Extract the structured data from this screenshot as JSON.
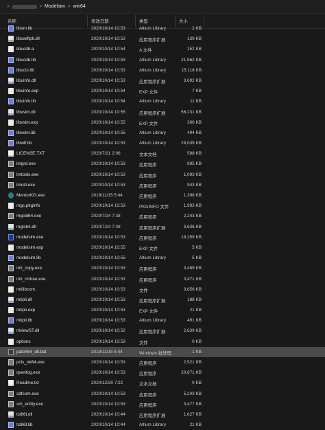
{
  "breadcrumb": {
    "sep": ">",
    "items": [
      "Modelsim",
      "win64"
    ]
  },
  "columns": {
    "name": "名称",
    "date": "修改日期",
    "type": "类型",
    "size": "大小"
  },
  "files": [
    {
      "name": "libsm.lib",
      "date": "2020/10/14 10:53",
      "type": "Altium Library",
      "size": "2 KB",
      "icon": "lib-icon"
    },
    {
      "name": "libswiftpli.dll",
      "date": "2020/10/14 10:53",
      "type": "应用程序扩展",
      "size": "139 KB",
      "icon": "dll-icon"
    },
    {
      "name": "libucdb.a",
      "date": "2020/10/14 10:54",
      "type": "A 文件",
      "size": "152 KB",
      "icon": "file-icon"
    },
    {
      "name": "libucdb.lib",
      "date": "2020/10/14 10:53",
      "type": "Altium Library",
      "size": "21,562 KB",
      "icon": "lib-icon"
    },
    {
      "name": "libucis.lib",
      "date": "2020/10/14 10:53",
      "type": "Altium Library",
      "size": "15,118 KB",
      "icon": "lib-icon"
    },
    {
      "name": "libuinfo.dll",
      "date": "2020/10/14 10:53",
      "type": "应用程序扩展",
      "size": "3,692 KB",
      "icon": "dll-icon"
    },
    {
      "name": "libuinfo.exp",
      "date": "2020/10/14 10:54",
      "type": "EXP 文件",
      "size": "7 KB",
      "icon": "file-icon"
    },
    {
      "name": "libuinfo.lib",
      "date": "2020/10/14 10:54",
      "type": "Altium Library",
      "size": "11 KB",
      "icon": "lib-icon"
    },
    {
      "name": "libvsim.dll",
      "date": "2020/10/14 10:55",
      "type": "应用程序扩展",
      "size": "56,231 KB",
      "icon": "dll-icon"
    },
    {
      "name": "libvsim.exp",
      "date": "2020/10/14 10:55",
      "type": "EXP 文件",
      "size": "300 KB",
      "icon": "file-icon"
    },
    {
      "name": "libvsim.lib",
      "date": "2020/10/14 10:55",
      "type": "Altium Library",
      "size": "494 KB",
      "icon": "lib-icon"
    },
    {
      "name": "libwlf.lib",
      "date": "2020/10/14 10:53",
      "type": "Altium Library",
      "size": "29,039 KB",
      "icon": "lib-icon"
    },
    {
      "name": "LICENSE.TXT",
      "date": "2023/7/21 2:06",
      "type": "文本文档",
      "size": "588 KB",
      "icon": "txt-icon"
    },
    {
      "name": "lmgrd.exe",
      "date": "2020/10/14 10:53",
      "type": "应用程序",
      "size": "895 KB",
      "icon": "exe-icon"
    },
    {
      "name": "lmtools.exe",
      "date": "2020/10/14 10:53",
      "type": "应用程序",
      "size": "1,093 KB",
      "icon": "exe-icon"
    },
    {
      "name": "lmutil.exe",
      "date": "2020/10/14 10:53",
      "type": "应用程序",
      "size": "943 KB",
      "icon": "exe-icon"
    },
    {
      "name": "MentorKG.exe",
      "date": "2018/11/15 5:44",
      "type": "应用程序",
      "size": "1,398 KB",
      "icon": "mentor-icon"
    },
    {
      "name": "mgc.pkginfo",
      "date": "2020/10/14 10:53",
      "type": "PKGINFO 文件",
      "size": "1,993 KB",
      "icon": "file-icon"
    },
    {
      "name": "mgcld64.exe",
      "date": "2020/7/24 7:38",
      "type": "应用程序",
      "size": "2,243 KB",
      "icon": "exe-icon"
    },
    {
      "name": "mgls64.dll",
      "date": "2020/7/24 7:38",
      "type": "应用程序扩展",
      "size": "3,636 KB",
      "icon": "dll-icon"
    },
    {
      "name": "modelsim.exe",
      "date": "2020/10/14 10:53",
      "type": "应用程序",
      "size": "19,259 KB",
      "icon": "modelsim-icon"
    },
    {
      "name": "modelsim.exp",
      "date": "2020/10/14 10:55",
      "type": "EXP 文件",
      "size": "5 KB",
      "icon": "file-icon"
    },
    {
      "name": "modelsim.lib",
      "date": "2020/10/14 10:55",
      "type": "Altium Library",
      "size": "5 KB",
      "icon": "lib-icon"
    },
    {
      "name": "mti_copy.exe",
      "date": "2020/10/14 10:53",
      "type": "应用程序",
      "size": "3,469 KB",
      "icon": "exe-icon"
    },
    {
      "name": "mti_rmtree.exe",
      "date": "2020/10/14 10:53",
      "type": "应用程序",
      "size": "3,471 KB",
      "icon": "exe-icon"
    },
    {
      "name": "mtilibcom",
      "date": "2020/10/14 10:53",
      "type": "文件",
      "size": "3,856 KB",
      "icon": "file-icon"
    },
    {
      "name": "mtipli.dll",
      "date": "2020/10/14 10:53",
      "type": "应用程序扩展",
      "size": "188 KB",
      "icon": "dll-icon"
    },
    {
      "name": "mtipli.exp",
      "date": "2020/10/14 10:53",
      "type": "EXP 文件",
      "size": "21 KB",
      "icon": "file-icon"
    },
    {
      "name": "mtipli.lib",
      "date": "2020/10/14 10:53",
      "type": "Altium Library",
      "size": "491 KB",
      "icon": "lib-icon"
    },
    {
      "name": "nlviewST.dll",
      "date": "2020/10/14 10:52",
      "type": "应用程序扩展",
      "size": "2,639 KB",
      "icon": "dll-icon"
    },
    {
      "name": "options",
      "date": "2020/10/14 10:53",
      "type": "文件",
      "size": "0 KB",
      "icon": "file-icon"
    },
    {
      "name": "patch64_dll.bat",
      "date": "2018/11/15 5:44",
      "type": "Windows 批处理...",
      "size": "1 KB",
      "icon": "bat-icon",
      "selected": true
    },
    {
      "name": "pcls_ok64.exe",
      "date": "2020/10/14 10:53",
      "type": "应用程序",
      "size": "2,521 KB",
      "icon": "exe-icon"
    },
    {
      "name": "qverilog.exe",
      "date": "2020/10/14 10:53",
      "type": "应用程序",
      "size": "20,871 KB",
      "icon": "exe-icon"
    },
    {
      "name": "Readme.txt",
      "date": "2020/12/30 7:22",
      "type": "文本文档",
      "size": "0 KB",
      "icon": "txt-icon"
    },
    {
      "name": "sdfcom.exe",
      "date": "2020/10/14 10:53",
      "type": "应用程序",
      "size": "5,243 KB",
      "icon": "exe-icon"
    },
    {
      "name": "sm_entity.exe",
      "date": "2020/10/14 10:53",
      "type": "应用程序",
      "size": "3,477 KB",
      "icon": "exe-icon"
    },
    {
      "name": "tcl86t.dll",
      "date": "2020/10/14 10:44",
      "type": "应用程序扩展",
      "size": "1,627 KB",
      "icon": "dll-icon"
    },
    {
      "name": "tcl86t.lib",
      "date": "2020/10/14 10:44",
      "type": "Altium Library",
      "size": "21 KB",
      "icon": "lib-icon"
    }
  ]
}
